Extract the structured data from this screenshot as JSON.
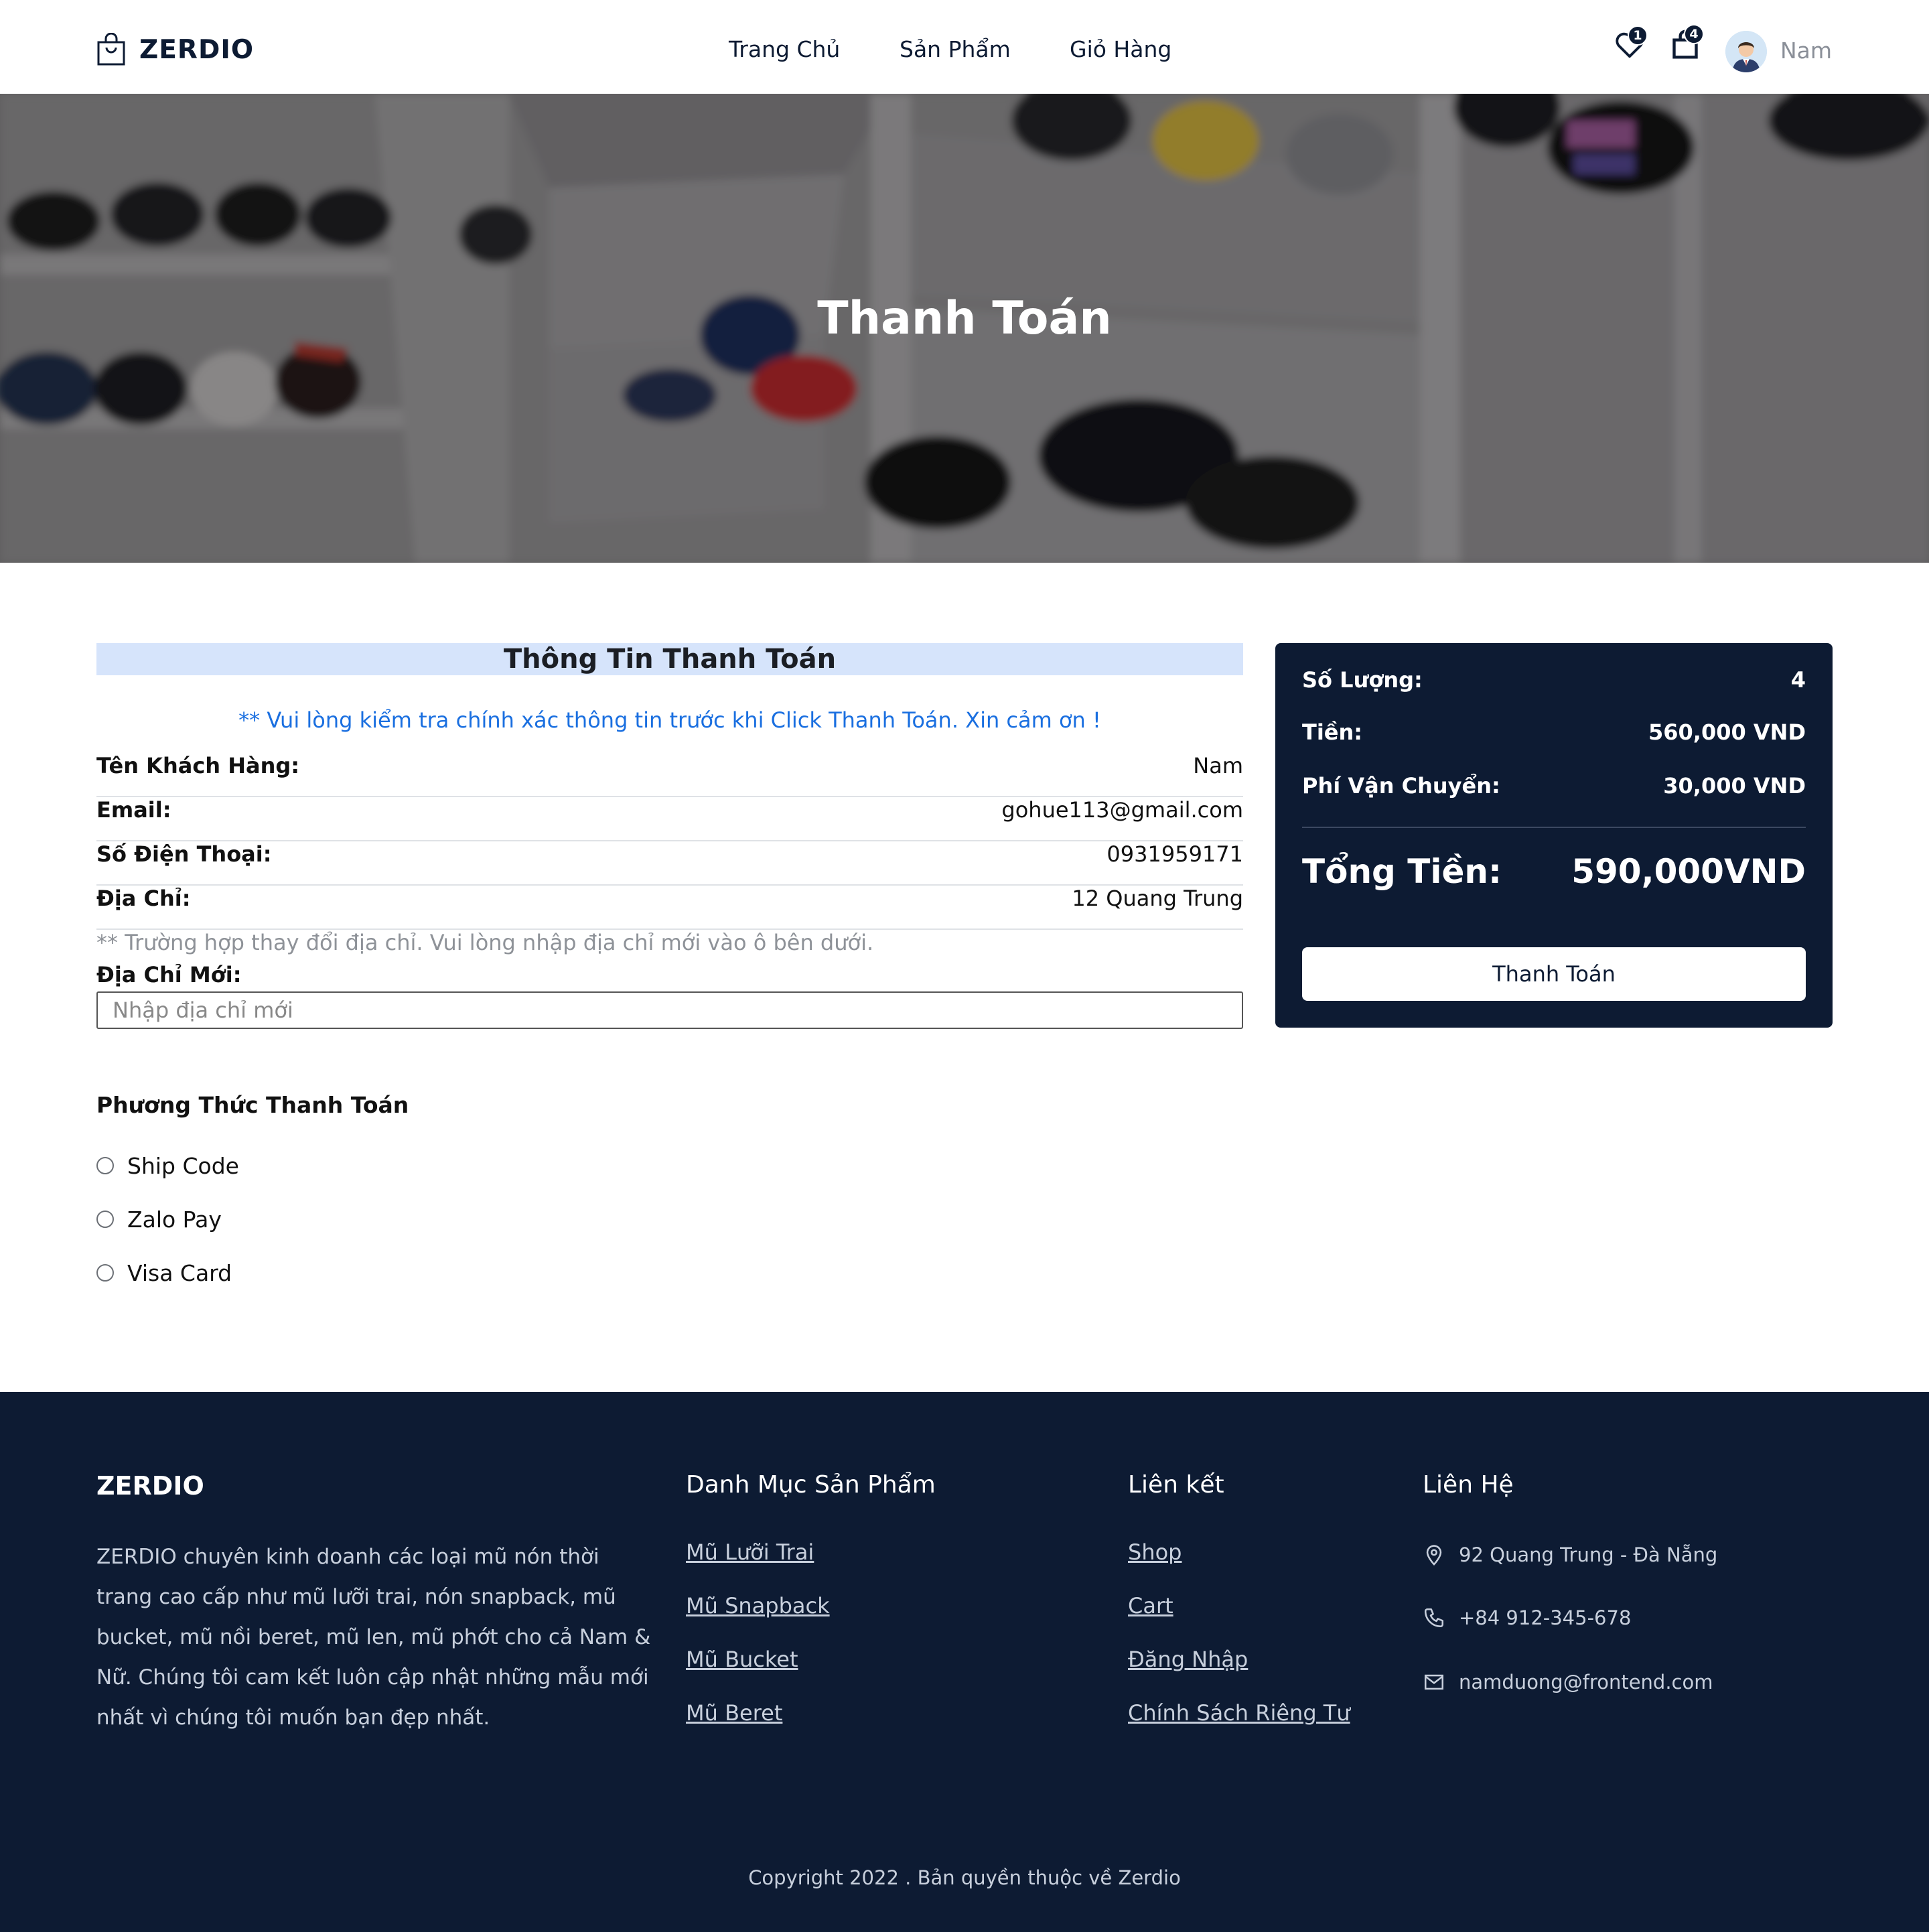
{
  "header": {
    "logo": "ZERDIO",
    "nav": [
      {
        "label": "Trang Chủ"
      },
      {
        "label": "Sản Phẩm"
      },
      {
        "label": "Giỏ Hàng"
      }
    ],
    "wishlist_count": "1",
    "cart_count": "4",
    "username": "Nam"
  },
  "hero": {
    "title": "Thanh Toán"
  },
  "billing": {
    "title": "Thông Tin Thanh Toán",
    "notice": "** Vui lòng kiểm tra chính xác thông tin trước khi Click Thanh Toán. Xin cảm ơn !",
    "rows": [
      {
        "label": "Tên Khách Hàng:",
        "value": "Nam"
      },
      {
        "label": "Email:",
        "value": "gohue113@gmail.com"
      },
      {
        "label": "Số Điện Thoại:",
        "value": "0931959171"
      },
      {
        "label": "Địa Chỉ:",
        "value": "12 Quang Trung"
      }
    ],
    "hint": "** Trường hợp thay đổi địa chỉ. Vui lòng nhập địa chỉ mới vào ô bên dưới.",
    "new_address_label": "Địa Chỉ Mới:",
    "new_address_placeholder": "Nhập địa chỉ mới"
  },
  "payment": {
    "title": "Phương Thức Thanh Toán",
    "options": [
      {
        "label": "Ship Code"
      },
      {
        "label": "Zalo Pay"
      },
      {
        "label": "Visa Card"
      }
    ]
  },
  "summary": {
    "quantity_label": "Số Lượng:",
    "quantity_value": "4",
    "money_label": "Tiền:",
    "money_value": "560,000 VND",
    "shipping_label": "Phí Vận Chuyển:",
    "shipping_value": "30,000 VND",
    "total_label": "Tổng Tiền:",
    "total_value": "590,000VND",
    "button": "Thanh Toán"
  },
  "footer": {
    "brand": "ZERDIO",
    "description": "ZERDIO chuyên kinh doanh các loại mũ nón thời trang cao cấp như mũ lưỡi trai, nón snapback, mũ bucket, mũ nồi beret, mũ len, mũ phớt cho cả Nam & Nữ. Chúng tôi cam kết luôn cập nhật những mẫu mới nhất vì chúng tôi muốn bạn đẹp nhất.",
    "categories": {
      "title": "Danh Mục Sản Phẩm",
      "items": [
        "Mũ Lưỡi Trai",
        "Mũ Snapback",
        "Mũ Bucket",
        "Mũ Beret"
      ]
    },
    "links": {
      "title": "Liên kết",
      "items": [
        "Shop",
        "Cart",
        "Đăng Nhập",
        "Chính Sách Riêng Tư"
      ]
    },
    "contact": {
      "title": "Liên Hệ",
      "address": "92 Quang Trung - Đà Nẵng",
      "phone": "+84 912-345-678",
      "email": "namduong@frontend.com"
    },
    "copyright": "Copyright 2022 . Bản quyền thuộc về Zerdio"
  },
  "colors": {
    "navy": "#0d1b33",
    "notice_blue": "#1a6fe0",
    "head_bg": "#d6e4fb"
  }
}
